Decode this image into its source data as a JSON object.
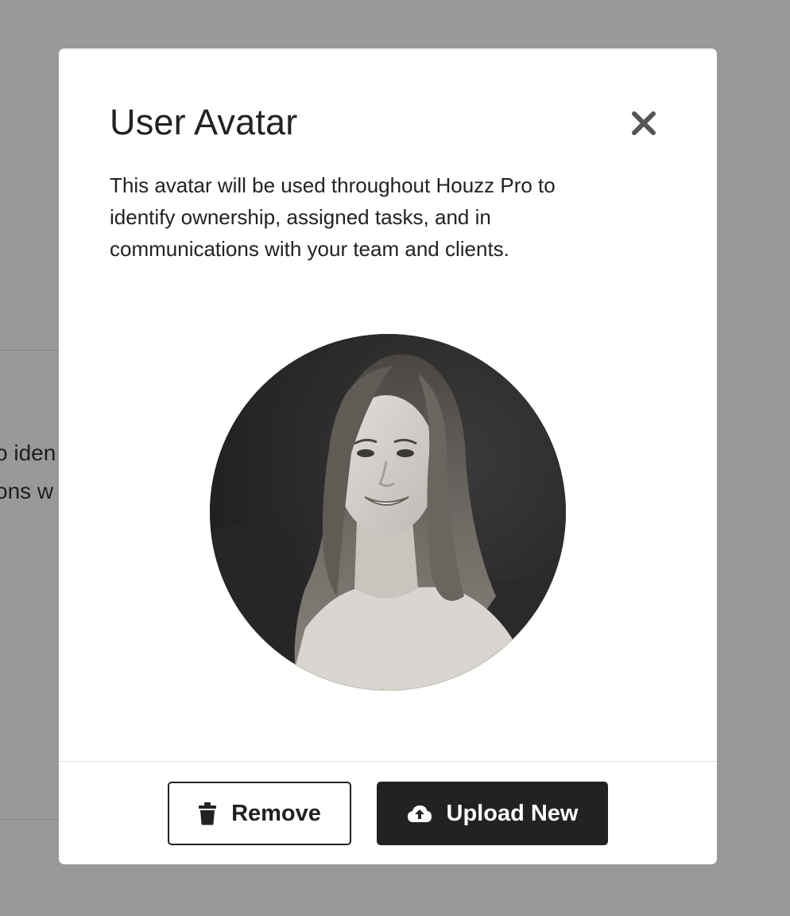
{
  "background": {
    "partial_text_line_1": "o iden",
    "partial_text_line_2": "ons w"
  },
  "modal": {
    "title": "User Avatar",
    "description": "This avatar will be used throughout Houzz Pro to identify ownership, assigned tasks, and in communications with your team and clients.",
    "close_icon": "close-icon",
    "avatar_image": "user-photo"
  },
  "footer": {
    "remove_label": "Remove",
    "remove_icon": "trash-icon",
    "upload_label": "Upload New",
    "upload_icon": "cloud-upload-icon"
  },
  "colors": {
    "overlay": "#999999",
    "modal_bg": "#ffffff",
    "text": "#222222",
    "primary_button": "#222222",
    "primary_button_text": "#ffffff"
  }
}
